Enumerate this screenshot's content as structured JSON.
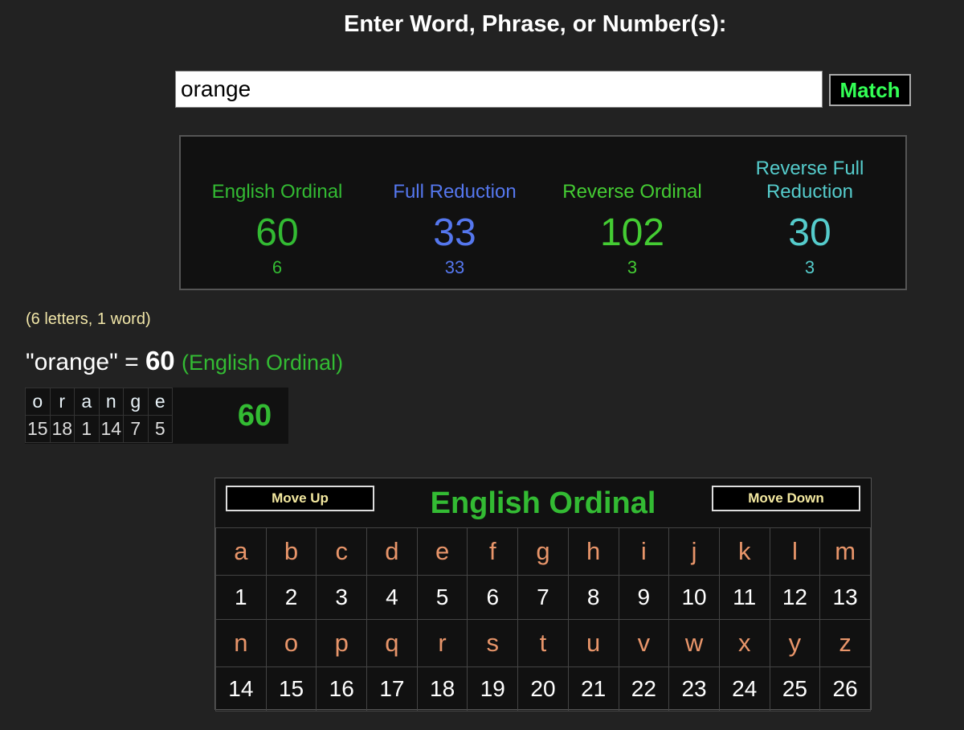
{
  "prompt": "Enter Word, Phrase, or Number(s):",
  "search": {
    "value": "orange"
  },
  "match_label": "Match",
  "colors": {
    "green": "#33bb33",
    "blue": "#5577ee",
    "bright_green": "#44cc33",
    "cyan": "#55cccc",
    "letter_orange": "#e8956a",
    "cream": "#f1e6a8"
  },
  "ciphers": [
    {
      "name_line1": "",
      "name_line2": "English Ordinal",
      "value": "60",
      "sub": "6"
    },
    {
      "name_line1": "",
      "name_line2": "Full Reduction",
      "value": "33",
      "sub": "33"
    },
    {
      "name_line1": "",
      "name_line2": "Reverse Ordinal",
      "value": "102",
      "sub": "3"
    },
    {
      "name_line1": "Reverse Full",
      "name_line2": "Reduction",
      "value": "30",
      "sub": "3"
    }
  ],
  "letter_count": "(6 letters, 1 word)",
  "result": {
    "phrase": "\"orange\"",
    "equals": "=",
    "value": "60",
    "cipher": "(English Ordinal)"
  },
  "breakdown": {
    "letters": [
      "o",
      "r",
      "a",
      "n",
      "g",
      "e"
    ],
    "numbers": [
      "15",
      "18",
      "1",
      "14",
      "7",
      "5"
    ],
    "total": "60"
  },
  "chart": {
    "move_up": "Move Up",
    "move_down": "Move Down",
    "title": "English Ordinal",
    "row1_letters": [
      "a",
      "b",
      "c",
      "d",
      "e",
      "f",
      "g",
      "h",
      "i",
      "j",
      "k",
      "l",
      "m"
    ],
    "row1_numbers": [
      "1",
      "2",
      "3",
      "4",
      "5",
      "6",
      "7",
      "8",
      "9",
      "10",
      "11",
      "12",
      "13"
    ],
    "row2_letters": [
      "n",
      "o",
      "p",
      "q",
      "r",
      "s",
      "t",
      "u",
      "v",
      "w",
      "x",
      "y",
      "z"
    ],
    "row2_numbers": [
      "14",
      "15",
      "16",
      "17",
      "18",
      "19",
      "20",
      "21",
      "22",
      "23",
      "24",
      "25",
      "26"
    ]
  }
}
